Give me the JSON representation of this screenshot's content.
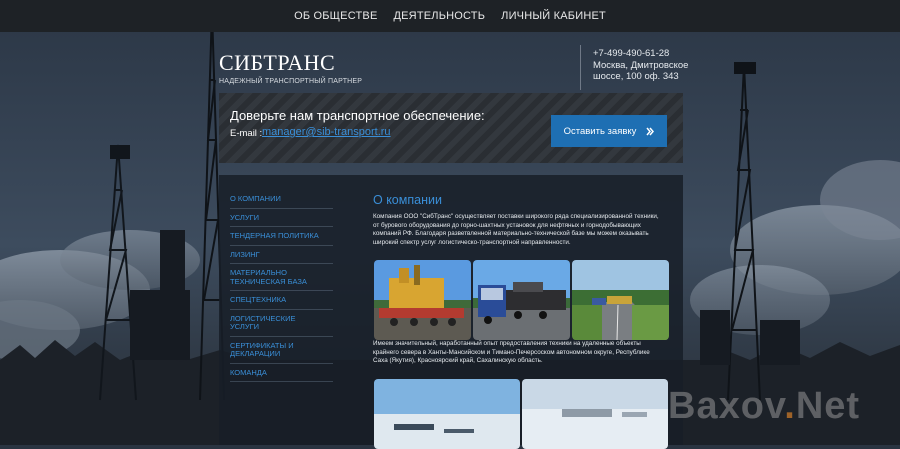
{
  "nav": {
    "items": [
      "ОБ ОБЩЕСТВЕ",
      "ДЕЯТЕЛЬНОСТЬ",
      "ЛИЧНЫЙ КАБИНЕТ"
    ]
  },
  "brand": {
    "title": "СИБТРАНС",
    "subtitle": "НАДЕЖНЫЙ ТРАНСПОРТНЫЙ ПАРТНЕР"
  },
  "contact": {
    "phone": "+7-499-490-61-28",
    "address_line1": "Москва, Дмитровское",
    "address_line2": "шоссе, 100 оф. 343"
  },
  "banner": {
    "title": "Доверьте нам транспортное обеспечение:",
    "email_label": "E-mail :",
    "email": "manager@sib-transport.ru",
    "button_label": "Оставить заявку",
    "button_icon": "double-chevron-right-icon"
  },
  "sidebar": {
    "items": [
      [
        "О КОМПАНИИ"
      ],
      [
        "УСЛУГИ"
      ],
      [
        "ТЕНДЕРНАЯ ПОЛИТИКА"
      ],
      [
        "ЛИЗИНГ"
      ],
      [
        "МАТЕРИАЛЬНО",
        "ТЕХНИЧЕСКАЯ БАЗА"
      ],
      [
        "СПЕЦТЕХНИКА"
      ],
      [
        "ЛОГИСТИЧЕСКИЕ",
        "УСЛУГИ"
      ],
      [
        "СЕРТИФИКАТЫ И",
        "ДЕКЛАРАЦИИ"
      ],
      [
        "КОМАНДА"
      ]
    ]
  },
  "content": {
    "title": "О компании",
    "paragraph1_lines": [
      "Компания ООО \"СибТранс\" осуществляет поставки широкого ряда специализированной техники,",
      "от бурового оборудования до горно-шахтных установок для нефтяных и горнодобывающих",
      "компаний РФ. Благодаря разветвленной материально-технической базе мы можем оказывать",
      "широкий спектр услуг логистическо-транспортной направленности."
    ],
    "paragraph2_lines": [
      "Имеем значительный, наработанный опыт предоставления техники на удаленные объекты",
      "крайнего севера в Ханты-Мансийском и Тимано-Печерсоском автономном округе, Республике",
      "Саха (Якутия), Красноярский край, Сахалинскую область."
    ]
  },
  "watermark": {
    "part1": "Baxov",
    "dot": ".",
    "part2": "Net"
  },
  "colors": {
    "accent": "#3a8fd8",
    "button": "#1e6fb3",
    "nav_bg": "#1e2226",
    "panel_bg": "#171e28"
  }
}
